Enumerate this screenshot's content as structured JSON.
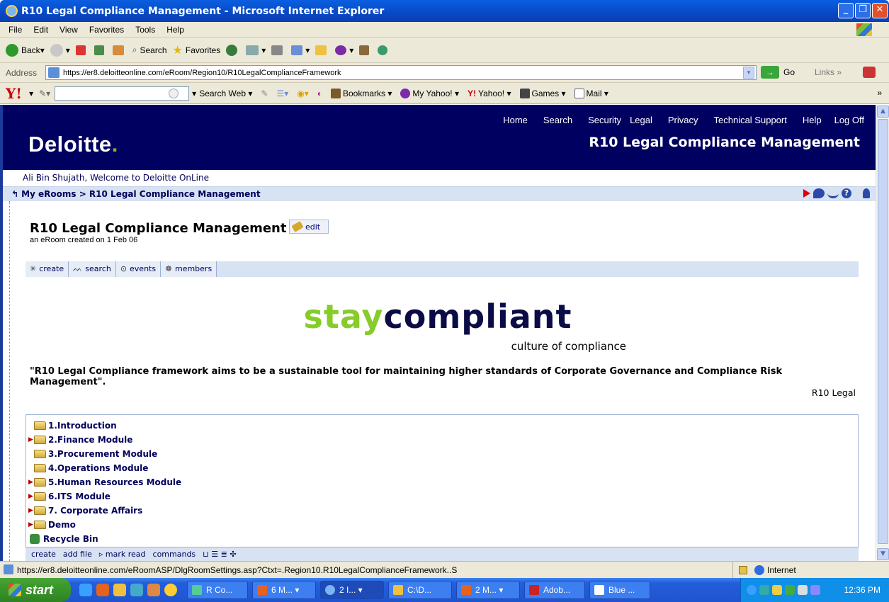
{
  "window": {
    "title": "R10 Legal Compliance Management - Microsoft Internet Explorer",
    "min": "_",
    "max": "❐",
    "close": "✕"
  },
  "menu": [
    "File",
    "Edit",
    "View",
    "Favorites",
    "Tools",
    "Help"
  ],
  "toolbar": {
    "back": "Back",
    "search": "Search",
    "favorites": "Favorites"
  },
  "address": {
    "label": "Address",
    "url": "https://er8.deloitteonline.com/eRoom/Region10/R10LegalComplianceFramework",
    "go": "Go",
    "links": "Links"
  },
  "yahoo": {
    "logo": "Y!",
    "search_web": "Search Web",
    "bookmarks": "Bookmarks",
    "my_yahoo": "My Yahoo!",
    "yahoo": "Yahoo!",
    "games": "Games",
    "mail": "Mail"
  },
  "header": {
    "logo": "Deloitte",
    "logo_dot": ".",
    "nav": [
      "Home",
      "Search",
      "Security",
      "Legal",
      "Privacy",
      "Technical Support",
      "Help",
      "Log Off"
    ],
    "room_title": "R10 Legal Compliance Management"
  },
  "welcome": "Ali Bin Shujath, Welcome to Deloitte OnLine",
  "breadcrumb": "My eRooms > R10 Legal Compliance Management",
  "room": {
    "name": "R10 Legal Compliance Management",
    "edit": "edit",
    "created": "an eRoom created on 1 Feb 06"
  },
  "actions": [
    {
      "icon": "✳",
      "label": "create"
    },
    {
      "icon": "ᨓ",
      "label": "search"
    },
    {
      "icon": "⊙",
      "label": "events"
    },
    {
      "icon": "☸",
      "label": "members"
    }
  ],
  "banner": {
    "stay": "stay",
    "compliant": "compliant",
    "tagline": "culture of compliance"
  },
  "quote": "\"R10 Legal Compliance framework aims to be a sustainable tool for maintaining higher standards of Corporate Governance and Compliance Risk Management\".",
  "quote_source": "R10 Legal",
  "folders": [
    {
      "label": "1.Introduction",
      "expandable": false
    },
    {
      "label": "2.Finance Module",
      "expandable": true
    },
    {
      "label": "3.Procurement Module",
      "expandable": false
    },
    {
      "label": "4.Operations Module",
      "expandable": false
    },
    {
      "label": "5.Human Resources Module",
      "expandable": true
    },
    {
      "label": "6.ITS Module",
      "expandable": true
    },
    {
      "label": "7. Corporate Affairs",
      "expandable": true
    },
    {
      "label": "Demo",
      "expandable": true
    }
  ],
  "recycle": "Recycle Bin",
  "bottombar": {
    "create": "create",
    "add_file": "add file",
    "mark_read": "▹ mark read",
    "commands": "commands"
  },
  "status": {
    "url": "https://er8.deloitteonline.com/eRoomASP/DlgRoomSettings.asp?Ctxt=.Region10.R10LegalComplianceFramework..S",
    "zone": "Internet"
  },
  "taskbar": {
    "start": "start",
    "tasks": [
      "R Co...",
      "6 M...",
      "2 I...",
      "C:\\D...",
      "2 M...",
      "Adob...",
      "Blue ..."
    ],
    "clock": "12:36 PM"
  },
  "colors": {
    "deloitte_navy": "#000060",
    "deloitte_green": "#86bc25",
    "xp_blue": "#245edb"
  }
}
